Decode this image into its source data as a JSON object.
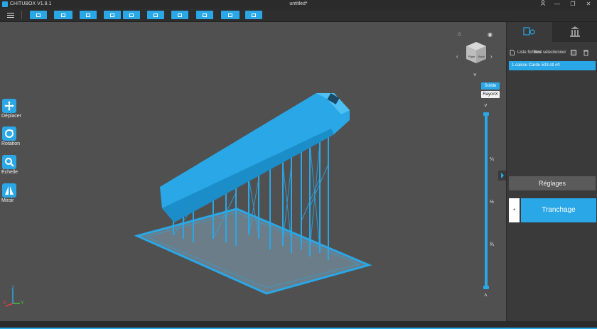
{
  "app": {
    "name": "CHITUBOX V1.8.1",
    "document_title": "untitled*"
  },
  "window_controls": {
    "account_icon": "user-icon",
    "minimize": "—",
    "maximize": "❐",
    "close": "✕"
  },
  "toolbar": {
    "menu_icon": "hamburger-icon",
    "buttons": [
      "open-project-icon",
      "open-file-icon",
      "save-icon",
      "import-icon",
      "export-icon",
      "layer-icon",
      "arrange-icon",
      "hollow-icon",
      "slice-preview-icon",
      "printer-icon"
    ]
  },
  "left_tools": [
    {
      "label": "Déplacer",
      "icon": "move-icon"
    },
    {
      "label": "Rotation",
      "icon": "rotate-icon"
    },
    {
      "label": "Échelle",
      "icon": "scale-icon"
    },
    {
      "label": "Miroir",
      "icon": "mirror-icon"
    }
  ],
  "view_modes": {
    "solid": "Solide",
    "xray": "RayonX"
  },
  "view_cube": {
    "faces": [
      "Top",
      "Right",
      "Back"
    ]
  },
  "layer_slider": {
    "ticks": [
      "¼",
      "½",
      "¾"
    ]
  },
  "axes": {
    "x": "X",
    "y": "Y",
    "z": "Z"
  },
  "right_panel": {
    "file_list_title": "Liste fichiers",
    "select_all_label": "Tout sélectionner",
    "files": [
      "1.caisse Carde 503.stl #0"
    ],
    "settings_label": "Réglages",
    "slice_plus": "+",
    "slice_label": "Tranchage"
  },
  "colors": {
    "accent": "#2aa7e6",
    "model": "#2aa7e6",
    "background": "#505050"
  }
}
